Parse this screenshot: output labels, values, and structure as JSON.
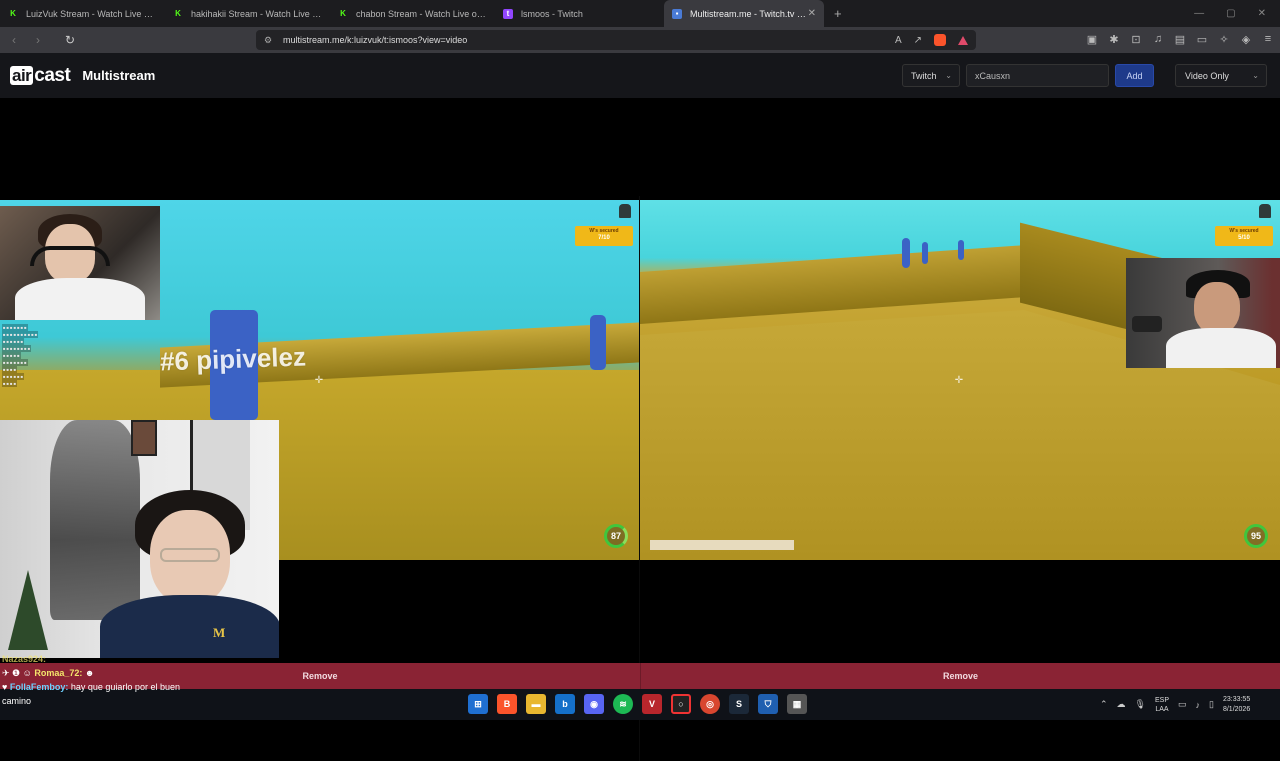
{
  "browser": {
    "tabs": [
      {
        "title": "LuizVuk Stream - Watch Live on Ki",
        "favicon": "kick-icon",
        "active": false
      },
      {
        "title": "hakihakii Stream - Watch Live on K",
        "favicon": "kick-icon",
        "active": false
      },
      {
        "title": "chabon Stream - Watch Live on Ki",
        "favicon": "kick-icon",
        "active": false
      },
      {
        "title": "lsmoos - Twitch",
        "favicon": "twitch-icon",
        "active": false
      },
      {
        "title": "Multistream.me - Twitch.tv / Ki",
        "favicon": "multistream-icon",
        "active": true
      }
    ],
    "url": "multistream.me/k:luizvuk/t:ismoos?view=video"
  },
  "site": {
    "logo_air": "air",
    "logo_cast": "cast",
    "title": "Multistream",
    "platform_select": "Twitch",
    "channel_input_value": "xCausxn",
    "add_label": "Add",
    "view_select": "Video Only"
  },
  "streams": {
    "left": {
      "overlay_text": "#6 pipivelez",
      "secured_label": "W's secured",
      "secured_count": "7/10",
      "timer": "87",
      "remove_label": "Remove"
    },
    "right": {
      "secured_label": "W's secured",
      "secured_count": "5/10",
      "timer": "95",
      "progress": 1.0,
      "remove_label": "Remove"
    }
  },
  "chat_overlay": [
    {
      "name": "Romaa_72:",
      "message": ""
    },
    {
      "name": "FollaFemboy:",
      "message": "hay que guiarlo por el buen camino"
    }
  ],
  "chat_overlay_top": "Nazas924:",
  "taskbar": {
    "lang_line1": "ESP",
    "lang_line2": "LAA",
    "time": "23:33:55",
    "date": "8/1/2026"
  }
}
